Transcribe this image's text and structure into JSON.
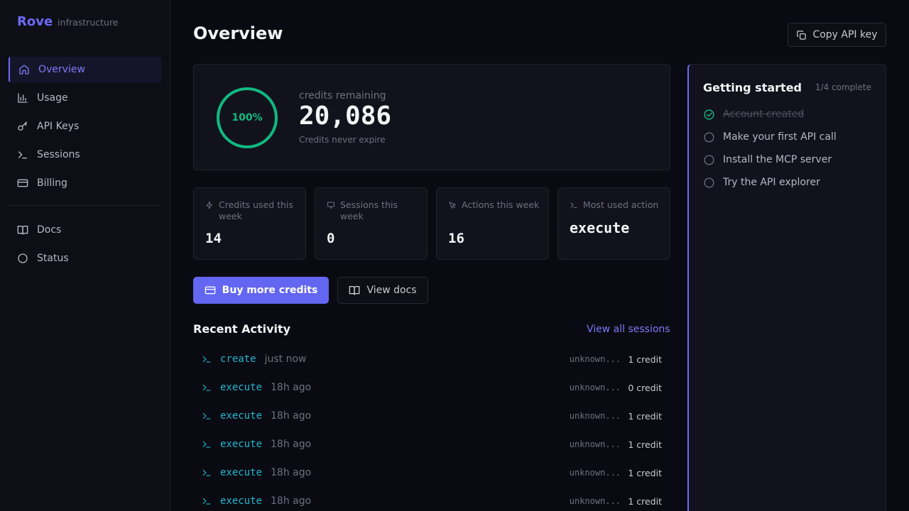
{
  "brand": {
    "name": "Rove",
    "subtitle": "infrastructure"
  },
  "sidebar": {
    "items": [
      {
        "label": "Overview",
        "icon": "home-icon",
        "active": true
      },
      {
        "label": "Usage",
        "icon": "bar-chart-icon"
      },
      {
        "label": "API Keys",
        "icon": "key-icon"
      },
      {
        "label": "Sessions",
        "icon": "terminal-icon"
      },
      {
        "label": "Billing",
        "icon": "credit-card-icon"
      }
    ],
    "secondary": [
      {
        "label": "Docs",
        "icon": "book-icon"
      },
      {
        "label": "Status",
        "icon": "circle-icon"
      }
    ]
  },
  "header": {
    "title": "Overview",
    "copy_api_key_label": "Copy API key"
  },
  "credits": {
    "percent_label": "100%",
    "percent_value": 1.0,
    "label": "credits remaining",
    "value": "20,086",
    "note": "Credits never expire"
  },
  "stats": [
    {
      "label": "Credits used this week",
      "value": "14",
      "icon": "zap-icon"
    },
    {
      "label": "Sessions this week",
      "value": "0",
      "icon": "monitor-icon"
    },
    {
      "label": "Actions this week",
      "value": "16",
      "icon": "cursor-icon"
    },
    {
      "label": "Most used action",
      "value": "execute",
      "icon": "terminal-icon"
    }
  ],
  "actions": {
    "buy_label": "Buy more credits",
    "docs_label": "View docs"
  },
  "recent_activity": {
    "title": "Recent Activity",
    "view_all_label": "View all sessions",
    "rows": [
      {
        "action": "create",
        "time": "just now",
        "session": "unknown...",
        "credits": "1 credit"
      },
      {
        "action": "execute",
        "time": "18h ago",
        "session": "unknown...",
        "credits": "0 credit"
      },
      {
        "action": "execute",
        "time": "18h ago",
        "session": "unknown...",
        "credits": "1 credit"
      },
      {
        "action": "execute",
        "time": "18h ago",
        "session": "unknown...",
        "credits": "1 credit"
      },
      {
        "action": "execute",
        "time": "18h ago",
        "session": "unknown...",
        "credits": "1 credit"
      },
      {
        "action": "execute",
        "time": "18h ago",
        "session": "unknown...",
        "credits": "1 credit"
      }
    ]
  },
  "getting_started": {
    "title": "Getting started",
    "progress": "1/4 complete",
    "items": [
      {
        "label": "Account created",
        "done": true
      },
      {
        "label": "Make your first API call",
        "done": false
      },
      {
        "label": "Install the MCP server",
        "done": false
      },
      {
        "label": "Try the API explorer",
        "done": false
      }
    ]
  },
  "colors": {
    "accent": "#6366f1",
    "ring": "#10b981",
    "action_text": "#22b8cf",
    "background": "#0a0a12"
  }
}
